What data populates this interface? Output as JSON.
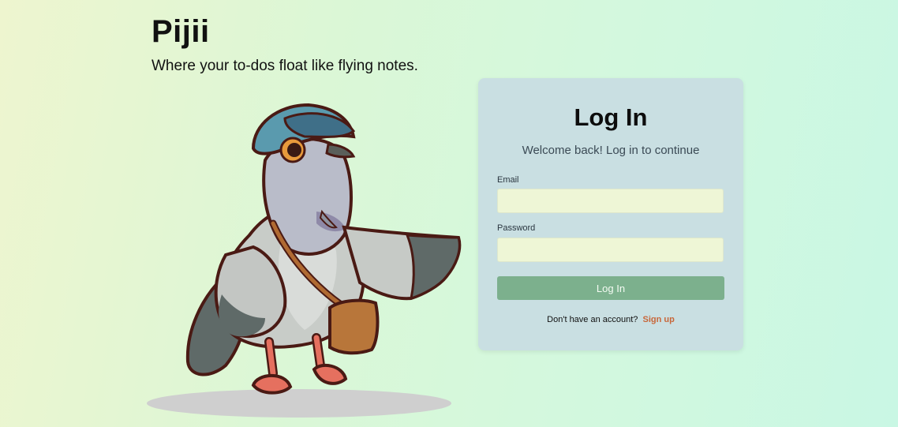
{
  "brand": {
    "title": "Pijii",
    "tagline": "Where your to-dos float like flying notes."
  },
  "illustration": {
    "icon": "pigeon-mail-carrier-illustration"
  },
  "login_card": {
    "title": "Log In",
    "subtitle": "Welcome back! Log in to continue",
    "email_label": "Email",
    "email_value": "",
    "password_label": "Password",
    "password_value": "",
    "submit_label": "Log In",
    "signup_prompt": "Don't have an account?",
    "signup_link": "Sign up"
  },
  "colors": {
    "card_bg": "#c9dfe2",
    "input_bg": "#eef6d6",
    "button_bg": "#7cb08d",
    "link": "#c8673a"
  }
}
